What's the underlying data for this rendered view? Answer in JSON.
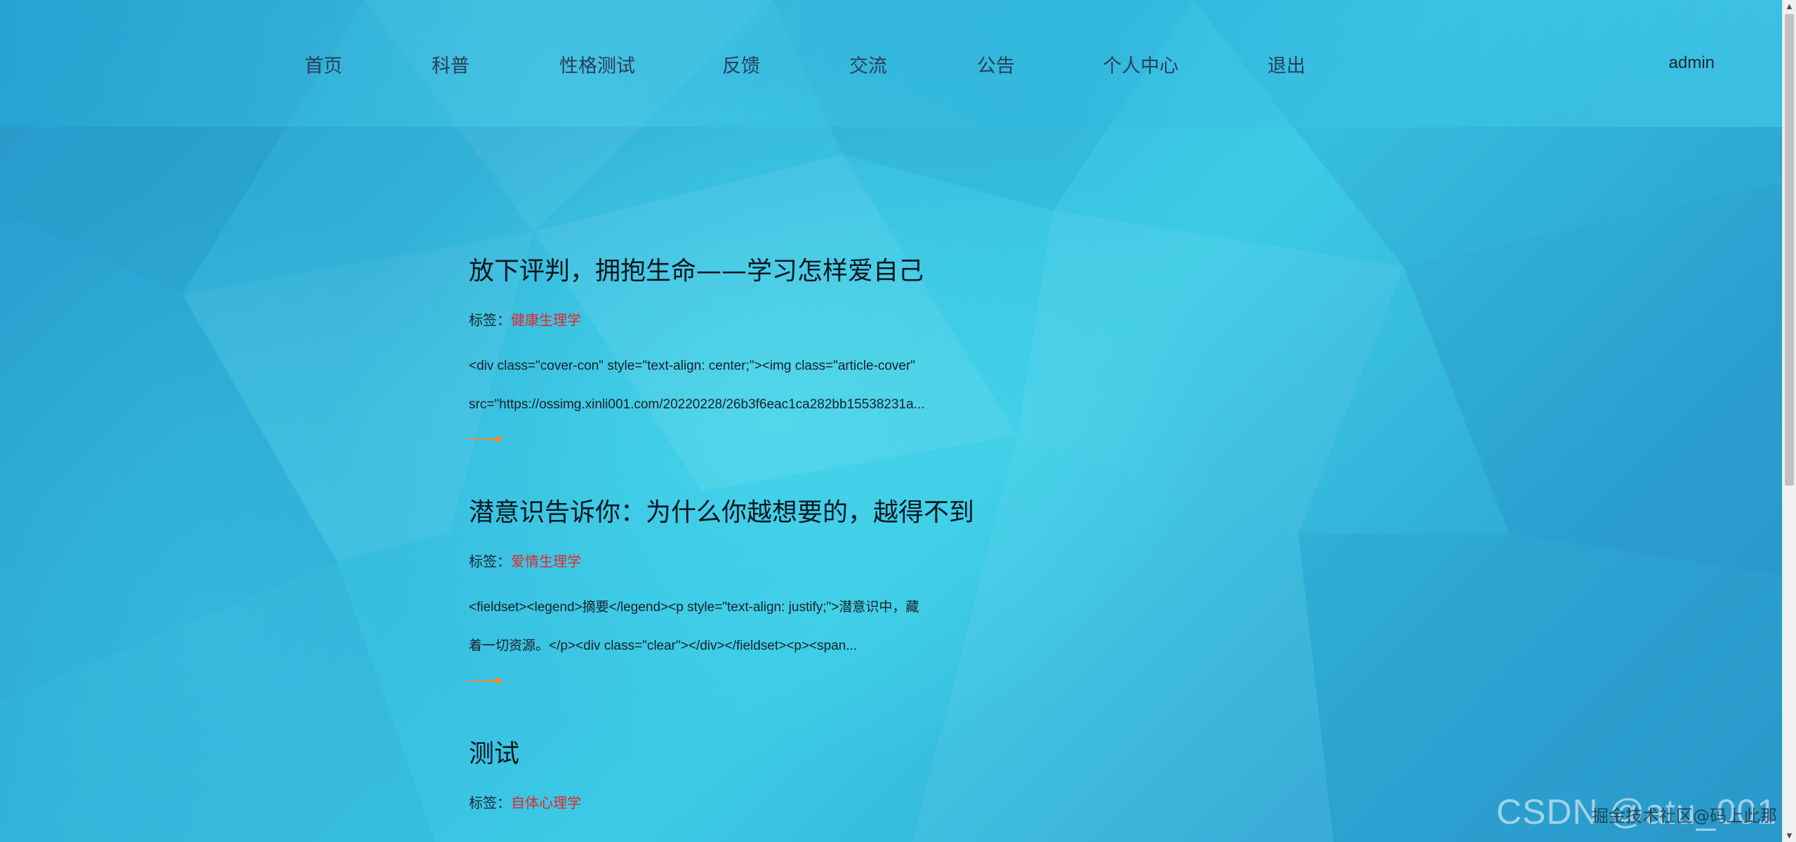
{
  "nav": {
    "items": [
      {
        "label": "首页"
      },
      {
        "label": "科普"
      },
      {
        "label": "性格测试"
      },
      {
        "label": "反馈"
      },
      {
        "label": "交流"
      },
      {
        "label": "公告"
      },
      {
        "label": "个人中心"
      },
      {
        "label": "退出"
      }
    ],
    "user": "admin"
  },
  "articles": [
    {
      "title": "放下评判，拥抱生命——学习怎样爱自己",
      "tag_label": "标签：",
      "tag": "健康生理学",
      "summary_line1": "<div class=\"cover-con\" style=\"text-align: center;\"><img class=\"article-cover\"",
      "summary_line2": "src=\"https://ossimg.xinli001.com/20220228/26b3f6eac1ca282bb15538231a..."
    },
    {
      "title": "潜意识告诉你：为什么你越想要的，越得不到",
      "tag_label": "标签：",
      "tag": "爱情生理学",
      "summary_line1": "<fieldset><legend>摘要</legend><p style=\"text-align: justify;\">潜意识中，藏",
      "summary_line2": "着一切资源。</p><div class=\"clear\"></div></fieldset><p><span..."
    },
    {
      "title": "测试",
      "tag_label": "标签：",
      "tag": "自体心理学"
    }
  ],
  "watermark": {
    "main": "CSDN @atu_001",
    "sub": "掘金技术社区@码上此那"
  },
  "colors": {
    "tag": "#e5262b",
    "arrow": "#f08a24",
    "nav_text": "#2a3e56"
  }
}
